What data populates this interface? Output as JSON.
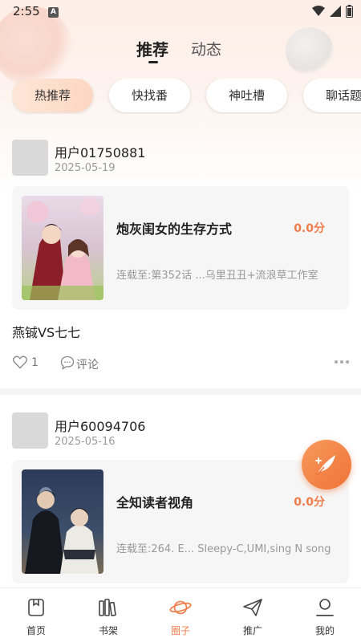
{
  "status_bar": {
    "time": "2:55",
    "notification_letter": "A"
  },
  "top_tabs": {
    "active": "推荐",
    "second": "动态"
  },
  "categories": [
    "热推荐",
    "快找番",
    "神吐槽",
    "聊话题"
  ],
  "posts": [
    {
      "username": "用户01750881",
      "date": "2025-05-19",
      "book_title": "炮灰闺女的生存方式",
      "score": "0.0分",
      "latest": "连载至:第352话 ...乌里丑丑+流浪草工作室",
      "text": "燕铖VS七七",
      "likes": "1",
      "comment_label": "评论"
    },
    {
      "username": "用户60094706",
      "date": "2025-05-16",
      "book_title": "全知读者视角",
      "score": "0.0分",
      "latest": "连载至:264. E...  Sleepy-C,UMI,sing N song"
    }
  ],
  "bottom_nav": [
    {
      "label": "首页",
      "icon": "home-icon"
    },
    {
      "label": "书架",
      "icon": "bookshelf-icon"
    },
    {
      "label": "圈子",
      "icon": "planet-icon"
    },
    {
      "label": "推广",
      "icon": "paper-plane-icon"
    },
    {
      "label": "我的",
      "icon": "profile-icon"
    }
  ],
  "colors": {
    "accent": "#ef7c4a",
    "fab": "#f07238"
  }
}
